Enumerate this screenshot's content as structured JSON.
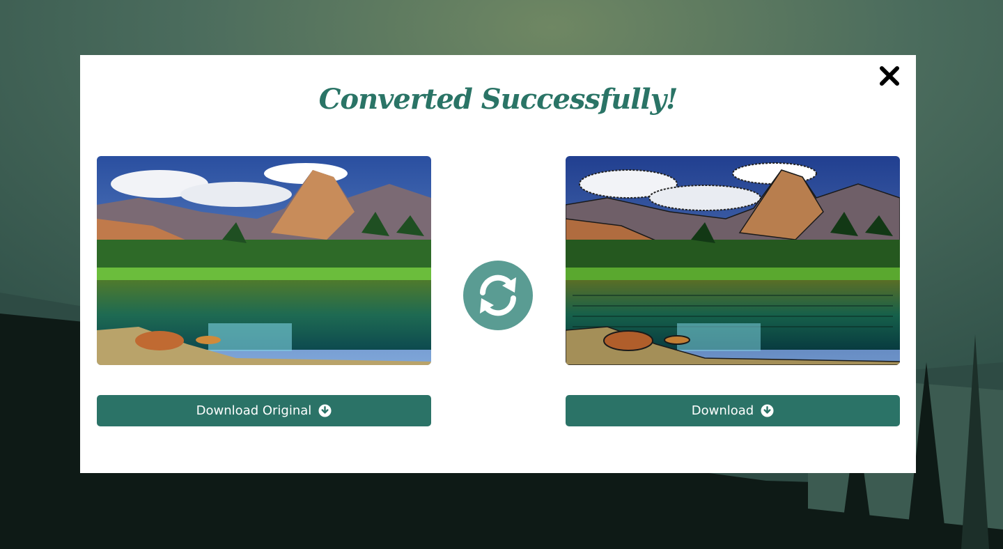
{
  "modal": {
    "title": "Converted Successfully!",
    "close_icon": "close-icon",
    "convert_icon": "refresh-icon",
    "original": {
      "image": "mountain-lake-photo",
      "button_label": "Download Original",
      "button_icon": "download-circle-icon"
    },
    "converted": {
      "image": "mountain-lake-cartoon-photo",
      "button_label": "Download",
      "button_icon": "download-circle-icon"
    }
  },
  "colors": {
    "accent": "#2b7367",
    "title": "#2a7466",
    "icon_circle": "#5a9c93"
  }
}
